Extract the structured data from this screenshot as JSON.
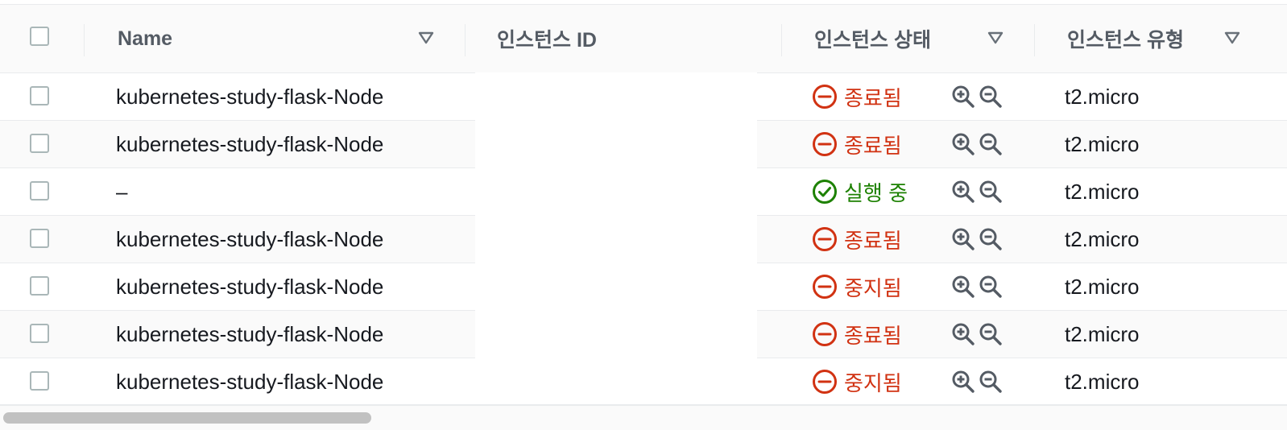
{
  "header": {
    "columns": [
      {
        "label": "Name"
      },
      {
        "label": "인스턴스 ID"
      },
      {
        "label": "인스턴스 상태"
      },
      {
        "label": "인스턴스 유형"
      }
    ]
  },
  "rows": [
    {
      "name": "kubernetes-study-flask-Node",
      "state": "종료됨",
      "state_kind": "stopped",
      "type": "t2.micro"
    },
    {
      "name": "kubernetes-study-flask-Node",
      "state": "종료됨",
      "state_kind": "stopped",
      "type": "t2.micro"
    },
    {
      "name": "–",
      "state": "실행 중",
      "state_kind": "running",
      "type": "t2.micro"
    },
    {
      "name": "kubernetes-study-flask-Node",
      "state": "종료됨",
      "state_kind": "stopped",
      "type": "t2.micro"
    },
    {
      "name": "kubernetes-study-flask-Node",
      "state": "중지됨",
      "state_kind": "stopped",
      "type": "t2.micro"
    },
    {
      "name": "kubernetes-study-flask-Node",
      "state": "종료됨",
      "state_kind": "stopped",
      "type": "t2.micro"
    },
    {
      "name": "kubernetes-study-flask-Node",
      "state": "중지됨",
      "state_kind": "stopped",
      "type": "t2.micro"
    }
  ],
  "colors": {
    "stopped": "#d13212",
    "running": "#1d8102",
    "header_text": "#545b64",
    "icon_gray": "#545b64"
  },
  "icons": {
    "stopped": "minus-circle-icon",
    "running": "check-circle-icon",
    "zoom_in": "zoom-in-icon",
    "zoom_out": "zoom-out-icon",
    "sort": "sort-down-icon"
  }
}
